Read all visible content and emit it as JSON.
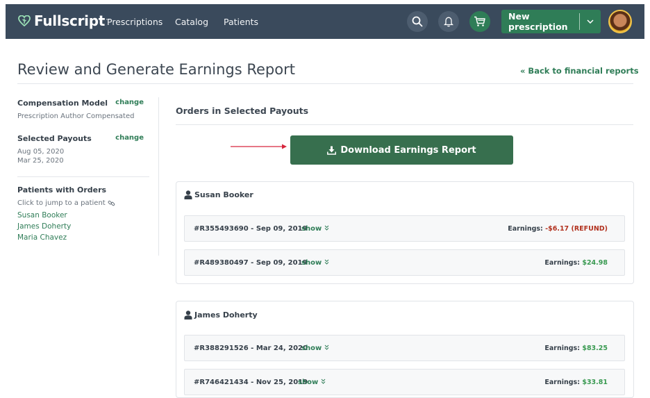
{
  "nav": {
    "brand": "Fullscript",
    "brand_tm": "™",
    "links": [
      "Prescriptions",
      "Catalog",
      "Patients"
    ],
    "new_prescription": "New prescription",
    "icons": [
      "search-icon",
      "bell-icon",
      "cart-icon",
      "chevron-down-icon"
    ],
    "colors": {
      "bar": "#3a4a5c",
      "accent": "#2f7d57"
    }
  },
  "page": {
    "title": "Review and Generate Earnings Report",
    "back_link": "« Back to financial reports"
  },
  "sidebar": {
    "compensation_title": "Compensation Model",
    "compensation_change": "change",
    "compensation_value": "Prescription Author Compensated",
    "payouts_title": "Selected Payouts",
    "payouts_change": "change",
    "payouts": [
      "Aug 05, 2020",
      "Mar 25, 2020"
    ],
    "patients_title": "Patients with Orders",
    "patients_hint": "Click to jump to a patient",
    "patients": [
      "Susan Booker",
      "James Doherty",
      "Maria Chavez"
    ]
  },
  "main": {
    "section_title": "Orders in Selected Payouts",
    "download_label": "Download Earnings Report",
    "patients": [
      {
        "name": "Susan Booker",
        "orders": [
          {
            "id": "#R355493690 - Sep 09, 2019",
            "show": "show",
            "earnings_label": "Earnings:",
            "earnings": "-$6.17 (REFUND)"
          },
          {
            "id": "#R489380497 - Sep 09, 2019",
            "show": "show",
            "earnings_label": "Earnings:",
            "earnings": "$24.98"
          }
        ]
      },
      {
        "name": "James Doherty",
        "orders": [
          {
            "id": "#R388291526 - Mar 24, 2020",
            "show": "show",
            "earnings_label": "Earnings:",
            "earnings": "$83.25"
          },
          {
            "id": "#R746421434 - Nov 25, 2019",
            "show": "show",
            "earnings_label": "Earnings:",
            "earnings": "$33.81"
          }
        ]
      }
    ]
  }
}
